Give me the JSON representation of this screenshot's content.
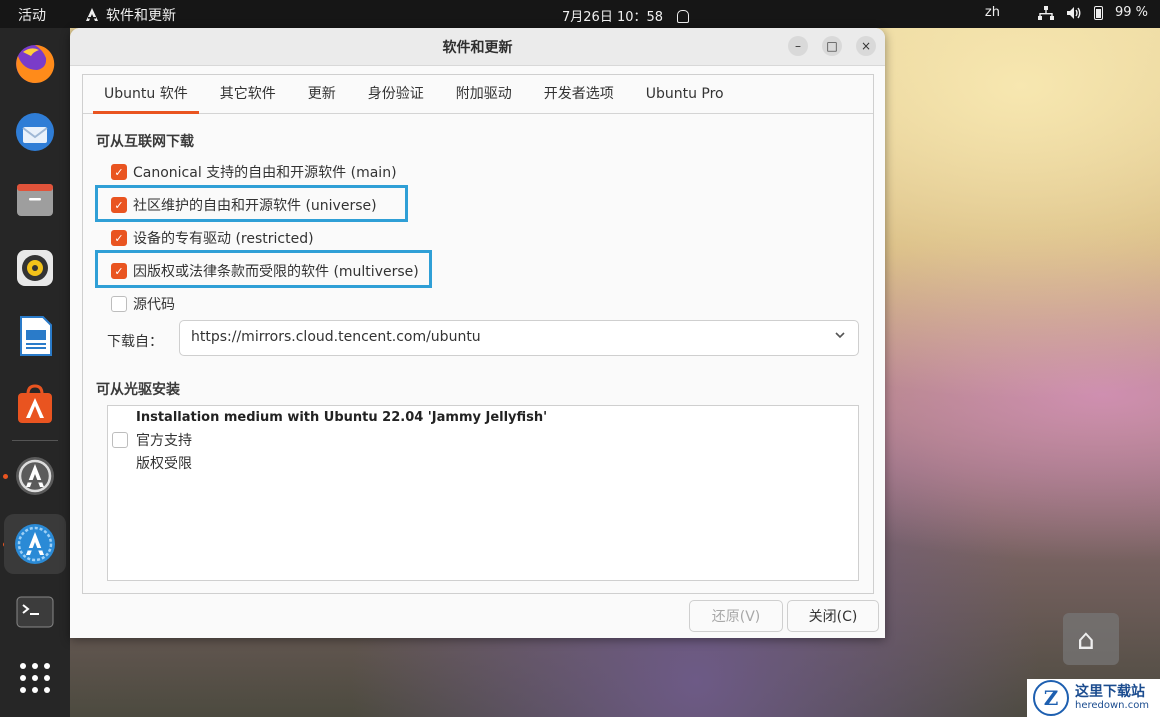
{
  "topbar": {
    "activities": "活动",
    "app_name": "软件和更新",
    "clock": "7月26日  10：58",
    "lang": "zh",
    "battery": "99 %"
  },
  "dock": {
    "items": [
      "firefox-icon",
      "thunderbird-icon",
      "files-icon",
      "rhythmbox-icon",
      "writer-icon",
      "app-center-icon",
      "software-updater-icon",
      "software-properties-icon",
      "terminal-icon",
      "show-apps-icon"
    ]
  },
  "window": {
    "title": "软件和更新",
    "controls": {
      "minimize": "–",
      "maximize": "□",
      "close": "×"
    }
  },
  "tabs": [
    {
      "label": "Ubuntu 软件",
      "active": true
    },
    {
      "label": "其它软件",
      "active": false
    },
    {
      "label": "更新",
      "active": false
    },
    {
      "label": "身份验证",
      "active": false
    },
    {
      "label": "附加驱动",
      "active": false
    },
    {
      "label": "开发者选项",
      "active": false
    },
    {
      "label": "Ubuntu Pro",
      "active": false
    }
  ],
  "internet": {
    "title": "可从互联网下载",
    "options": [
      {
        "label": "Canonical 支持的自由和开源软件 (main)",
        "checked": true
      },
      {
        "label": "社区维护的自由和开源软件 (universe)",
        "checked": true
      },
      {
        "label": "设备的专有驱动 (restricted)",
        "checked": true
      },
      {
        "label": "因版权或法律条款而受限的软件 (multiverse)",
        "checked": true
      },
      {
        "label": "源代码",
        "checked": false
      }
    ],
    "download_from_label": "下载自：",
    "download_from_value": "https://mirrors.cloud.tencent.com/ubuntu"
  },
  "cdrom": {
    "title": "可从光驱安装",
    "medium_title": "Installation medium with Ubuntu 22.04 'Jammy Jellyfish'",
    "line1": "官方支持",
    "line2": "版权受限"
  },
  "buttons": {
    "revert": "还原(V)",
    "close": "关闭(C)"
  },
  "watermark": {
    "letter": "Z",
    "cn": "这里下载站",
    "en": "heredown.com"
  },
  "colors": {
    "accent": "#e95420",
    "highlight": "#2f9fd6",
    "topbar": "#161616",
    "dock": "#262626"
  }
}
